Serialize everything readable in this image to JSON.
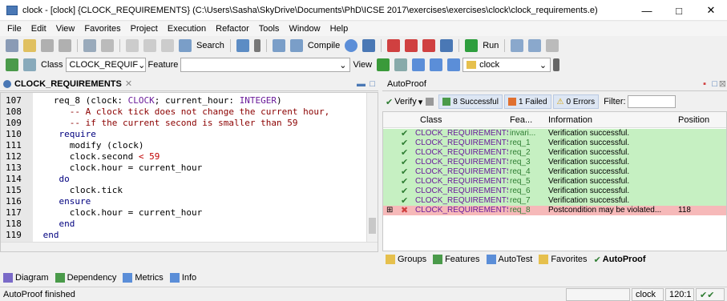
{
  "window": {
    "title": "clock - [clock] {CLOCK_REQUIREMENTS} (C:\\Users\\Sasha\\SkyDrive\\Documents\\PhD\\ICSE 2017\\exercises\\exercises\\clock\\clock_requirements.e)",
    "minimize": "—",
    "maximize": "□",
    "close": "✕"
  },
  "menu": [
    "File",
    "Edit",
    "View",
    "Favorites",
    "Project",
    "Execution",
    "Refactor",
    "Tools",
    "Window",
    "Help"
  ],
  "toolbar1": {
    "search_label": "Search",
    "compile_label": "Compile",
    "run_label": "Run"
  },
  "toolbar2": {
    "class_label": "Class",
    "class_value": "CLOCK_REQUIF",
    "feature_label": "Feature",
    "feature_value": "",
    "view_label": "View",
    "cluster_value": "clock"
  },
  "editor": {
    "tab_label": "CLOCK_REQUIREMENTS",
    "lines": [
      {
        "num": "107",
        "segments": [
          {
            "t": "   req_8 (clock: ",
            "c": ""
          },
          {
            "t": "CLOCK",
            "c": "ty"
          },
          {
            "t": "; current_hour: ",
            "c": ""
          },
          {
            "t": "INTEGER",
            "c": "ty"
          },
          {
            "t": ")",
            "c": ""
          }
        ]
      },
      {
        "num": "108",
        "segments": [
          {
            "t": "      -- A clock tick does not change the current hour,",
            "c": "cm"
          }
        ]
      },
      {
        "num": "109",
        "segments": [
          {
            "t": "      -- if the current second is smaller than 59",
            "c": "cm"
          }
        ]
      },
      {
        "num": "110",
        "segments": [
          {
            "t": "    require",
            "c": "kw"
          }
        ]
      },
      {
        "num": "111",
        "segments": [
          {
            "t": "      modify (clock)",
            "c": ""
          }
        ]
      },
      {
        "num": "112",
        "segments": [
          {
            "t": "      clock.second ",
            "c": ""
          },
          {
            "t": "< 59",
            "c": "num"
          }
        ]
      },
      {
        "num": "113",
        "segments": [
          {
            "t": "      clock.hour = current_hour",
            "c": ""
          }
        ]
      },
      {
        "num": "114",
        "segments": [
          {
            "t": "    do",
            "c": "kw"
          }
        ]
      },
      {
        "num": "115",
        "segments": [
          {
            "t": "      clock.tick",
            "c": ""
          }
        ]
      },
      {
        "num": "116",
        "segments": [
          {
            "t": "    ensure",
            "c": "kw"
          }
        ]
      },
      {
        "num": "117",
        "segments": [
          {
            "t": "      clock.hour = current_hour",
            "c": ""
          }
        ]
      },
      {
        "num": "118",
        "segments": [
          {
            "t": "    end",
            "c": "kw"
          }
        ]
      },
      {
        "num": "119",
        "segments": [
          {
            "t": " end",
            "c": "kw"
          }
        ]
      }
    ]
  },
  "autoproof": {
    "tab_label": "AutoProof",
    "verify_label": "Verify",
    "successful": "8 Successful",
    "failed": "1 Failed",
    "errors": "0 Errors",
    "filter_label": "Filter:",
    "columns": [
      "Class",
      "Fea...",
      "Information",
      "Position"
    ],
    "rows": [
      {
        "cls": "CLOCK_REQUIREMENTS",
        "fea": "invari...",
        "info": "Verification successful.",
        "pos": "",
        "status": "ok"
      },
      {
        "cls": "CLOCK_REQUIREMENTS",
        "fea": "req_1",
        "info": "Verification successful.",
        "pos": "",
        "status": "ok"
      },
      {
        "cls": "CLOCK_REQUIREMENTS",
        "fea": "req_2",
        "info": "Verification successful.",
        "pos": "",
        "status": "ok"
      },
      {
        "cls": "CLOCK_REQUIREMENTS",
        "fea": "req_3",
        "info": "Verification successful.",
        "pos": "",
        "status": "ok"
      },
      {
        "cls": "CLOCK_REQUIREMENTS",
        "fea": "req_4",
        "info": "Verification successful.",
        "pos": "",
        "status": "ok"
      },
      {
        "cls": "CLOCK_REQUIREMENTS",
        "fea": "req_5",
        "info": "Verification successful.",
        "pos": "",
        "status": "ok"
      },
      {
        "cls": "CLOCK_REQUIREMENTS",
        "fea": "req_6",
        "info": "Verification successful.",
        "pos": "",
        "status": "ok"
      },
      {
        "cls": "CLOCK_REQUIREMENTS",
        "fea": "req_7",
        "info": "Verification successful.",
        "pos": "",
        "status": "ok"
      },
      {
        "cls": "CLOCK_REQUIREMENTS",
        "fea": "req_8",
        "info": "Postcondition may be violated...",
        "pos": "118",
        "status": "fail"
      }
    ],
    "bottom_tabs": [
      "Groups",
      "Features",
      "AutoTest",
      "Favorites",
      "AutoProof"
    ]
  },
  "left_bottom_tabs": [
    "Diagram",
    "Dependency",
    "Metrics",
    "Info"
  ],
  "status": {
    "message": "AutoProof finished",
    "cluster": "clock",
    "position": "120:1"
  }
}
